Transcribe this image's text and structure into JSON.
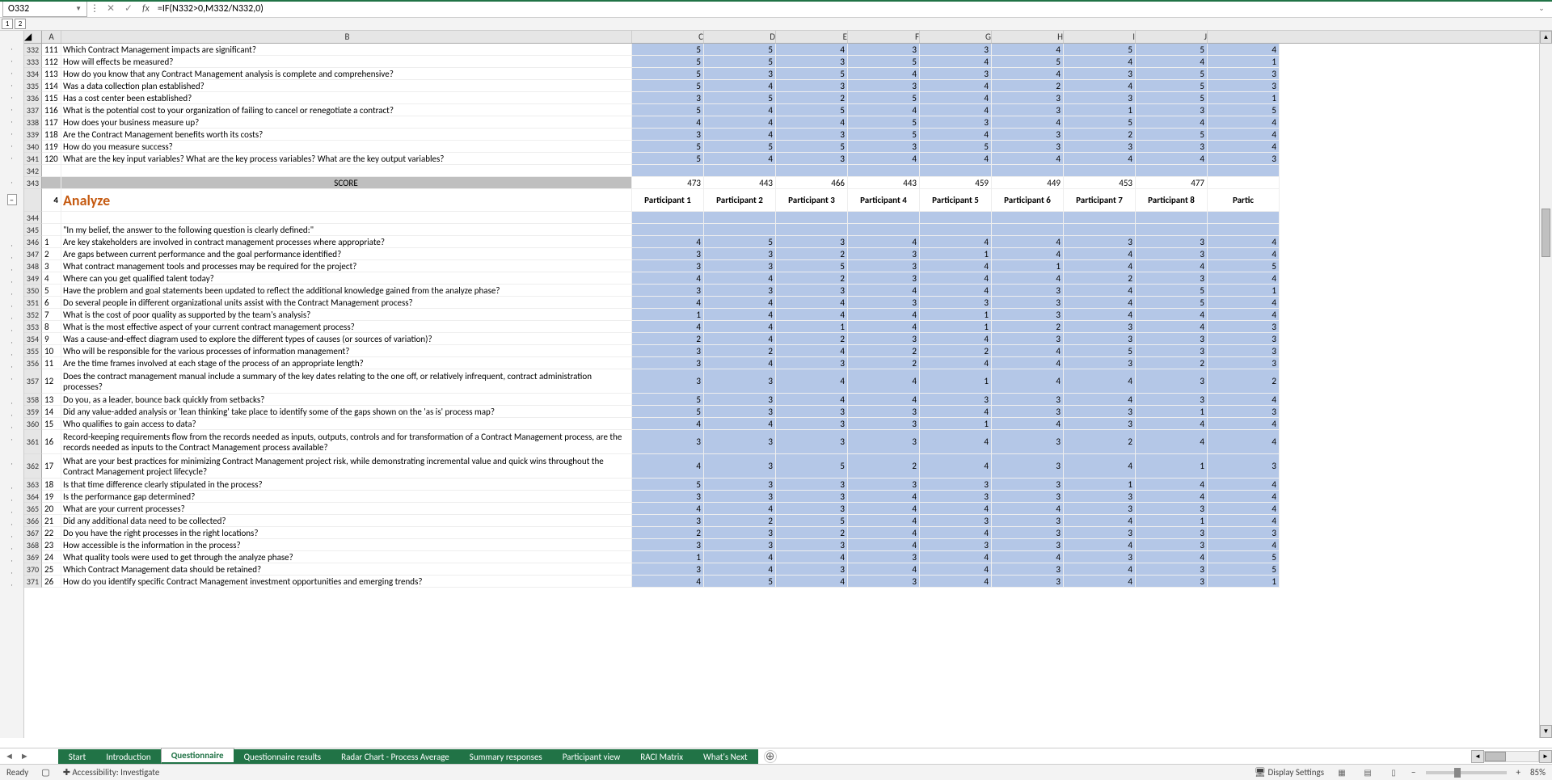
{
  "name_box": "O332",
  "formula": "=IF(N332>0,M332/N332,0)",
  "outline_levels": [
    "1",
    "2"
  ],
  "columns": [
    "A",
    "B",
    "C",
    "D",
    "E",
    "F",
    "G",
    "H",
    "I",
    "J"
  ],
  "rows_top": [
    {
      "r": "332",
      "a": "111",
      "b": "Which Contract Management impacts are significant?",
      "v": [
        "5",
        "5",
        "4",
        "3",
        "3",
        "4",
        "5",
        "5",
        "4"
      ]
    },
    {
      "r": "333",
      "a": "112",
      "b": "How will effects be measured?",
      "v": [
        "5",
        "5",
        "3",
        "5",
        "4",
        "5",
        "4",
        "4",
        "1"
      ]
    },
    {
      "r": "334",
      "a": "113",
      "b": "How do you know that any Contract Management analysis is complete and comprehensive?",
      "v": [
        "5",
        "3",
        "5",
        "4",
        "3",
        "4",
        "3",
        "5",
        "3"
      ]
    },
    {
      "r": "335",
      "a": "114",
      "b": "Was a data collection plan established?",
      "v": [
        "5",
        "4",
        "3",
        "3",
        "4",
        "2",
        "4",
        "5",
        "3"
      ]
    },
    {
      "r": "336",
      "a": "115",
      "b": "Has a cost center been established?",
      "v": [
        "3",
        "5",
        "2",
        "5",
        "4",
        "3",
        "3",
        "5",
        "1"
      ]
    },
    {
      "r": "337",
      "a": "116",
      "b": "What is the potential cost to your organization of failing to cancel or renegotiate a contract?",
      "v": [
        "5",
        "4",
        "5",
        "4",
        "4",
        "3",
        "1",
        "3",
        "5"
      ]
    },
    {
      "r": "338",
      "a": "117",
      "b": "How does your business measure up?",
      "v": [
        "4",
        "4",
        "4",
        "5",
        "3",
        "4",
        "5",
        "4",
        "4"
      ]
    },
    {
      "r": "339",
      "a": "118",
      "b": "Are the Contract Management benefits worth its costs?",
      "v": [
        "3",
        "4",
        "3",
        "5",
        "4",
        "3",
        "2",
        "5",
        "4"
      ]
    },
    {
      "r": "340",
      "a": "119",
      "b": "How do you measure success?",
      "v": [
        "5",
        "5",
        "5",
        "3",
        "5",
        "3",
        "3",
        "3",
        "4"
      ]
    },
    {
      "r": "341",
      "a": "120",
      "b": "What are the key input variables? What are the key process variables? What are the key output variables?",
      "v": [
        "5",
        "4",
        "3",
        "4",
        "4",
        "4",
        "4",
        "4",
        "3"
      ]
    }
  ],
  "row_blank": {
    "r": "342"
  },
  "score_row": {
    "r": "343",
    "label": "SCORE",
    "v": [
      "473",
      "443",
      "466",
      "443",
      "459",
      "449",
      "453",
      "477",
      ""
    ]
  },
  "section": {
    "num": "4",
    "title": "Analyze",
    "headers": [
      "Participant 1",
      "Participant 2",
      "Participant 3",
      "Participant 4",
      "Participant 5",
      "Participant 6",
      "Participant 7",
      "Participant 8",
      "Partic"
    ]
  },
  "row_344": {
    "r": "344"
  },
  "row_intro": {
    "r": "345",
    "b": "\"In my belief, the answer to the following question is clearly defined:\""
  },
  "rows_analyze": [
    {
      "r": "346",
      "a": "1",
      "b": "Are key stakeholders are involved in contract management processes where appropriate?",
      "v": [
        "4",
        "5",
        "3",
        "4",
        "4",
        "4",
        "3",
        "3",
        "4"
      ]
    },
    {
      "r": "347",
      "a": "2",
      "b": "Are gaps between current performance and the goal performance identified?",
      "v": [
        "3",
        "3",
        "2",
        "3",
        "1",
        "4",
        "4",
        "3",
        "4"
      ]
    },
    {
      "r": "348",
      "a": "3",
      "b": "What contract management tools and processes may be required for the project?",
      "v": [
        "3",
        "3",
        "5",
        "3",
        "4",
        "1",
        "4",
        "4",
        "5"
      ]
    },
    {
      "r": "349",
      "a": "4",
      "b": "Where can you get qualified talent today?",
      "v": [
        "4",
        "4",
        "2",
        "3",
        "4",
        "4",
        "2",
        "3",
        "4"
      ]
    },
    {
      "r": "350",
      "a": "5",
      "b": "Have the problem and goal statements been updated to reflect the additional knowledge gained from the analyze phase?",
      "v": [
        "3",
        "3",
        "3",
        "4",
        "4",
        "3",
        "4",
        "5",
        "1"
      ]
    },
    {
      "r": "351",
      "a": "6",
      "b": "Do several people in different organizational units assist with the Contract Management process?",
      "v": [
        "4",
        "4",
        "4",
        "3",
        "3",
        "3",
        "4",
        "5",
        "4"
      ]
    },
    {
      "r": "352",
      "a": "7",
      "b": "What is the cost of poor quality as supported by the team's analysis?",
      "v": [
        "1",
        "4",
        "4",
        "4",
        "1",
        "3",
        "4",
        "4",
        "4"
      ]
    },
    {
      "r": "353",
      "a": "8",
      "b": "What is the most effective aspect of your current contract management process?",
      "v": [
        "4",
        "4",
        "1",
        "4",
        "1",
        "2",
        "3",
        "4",
        "3"
      ]
    },
    {
      "r": "354",
      "a": "9",
      "b": "Was a cause-and-effect diagram used to explore the different types of causes (or sources of variation)?",
      "v": [
        "2",
        "4",
        "2",
        "3",
        "4",
        "3",
        "3",
        "3",
        "3"
      ]
    },
    {
      "r": "355",
      "a": "10",
      "b": "Who will be responsible for the various processes of information management?",
      "v": [
        "3",
        "2",
        "4",
        "2",
        "2",
        "4",
        "5",
        "3",
        "3"
      ]
    },
    {
      "r": "356",
      "a": "11",
      "b": "Are the time frames involved at each stage of the process of an appropriate length?",
      "v": [
        "3",
        "4",
        "3",
        "2",
        "4",
        "4",
        "3",
        "2",
        "3"
      ]
    },
    {
      "r": "357",
      "a": "12",
      "b": "Does the contract management manual include a summary of the key dates relating to the one off, or relatively infrequent, contract administration processes?",
      "v": [
        "3",
        "3",
        "4",
        "4",
        "1",
        "4",
        "4",
        "3",
        "2"
      ],
      "wrap": true
    },
    {
      "r": "358",
      "a": "13",
      "b": "Do you, as a leader, bounce back quickly from setbacks?",
      "v": [
        "5",
        "3",
        "4",
        "4",
        "3",
        "3",
        "4",
        "3",
        "4"
      ]
    },
    {
      "r": "359",
      "a": "14",
      "b": "Did any value-added analysis or 'lean thinking' take place to identify some of the gaps shown on the 'as is' process map?",
      "v": [
        "5",
        "3",
        "3",
        "3",
        "4",
        "3",
        "3",
        "1",
        "3"
      ]
    },
    {
      "r": "360",
      "a": "15",
      "b": "Who qualifies to gain access to data?",
      "v": [
        "4",
        "4",
        "3",
        "3",
        "1",
        "4",
        "3",
        "4",
        "4"
      ]
    },
    {
      "r": "361",
      "a": "16",
      "b": "Record-keeping requirements flow from the records needed as inputs, outputs, controls and for transformation of a Contract Management process, are the records needed as inputs to the Contract Management process available?",
      "v": [
        "3",
        "3",
        "3",
        "3",
        "4",
        "3",
        "2",
        "4",
        "4"
      ],
      "wrap": true
    },
    {
      "r": "362",
      "a": "17",
      "b": "What are your best practices for minimizing Contract Management project risk, while demonstrating incremental value and quick wins throughout the Contract Management project lifecycle?",
      "v": [
        "4",
        "3",
        "5",
        "2",
        "4",
        "3",
        "4",
        "1",
        "3"
      ],
      "wrap": true
    },
    {
      "r": "363",
      "a": "18",
      "b": "Is that time difference clearly stipulated in the process?",
      "v": [
        "5",
        "3",
        "3",
        "3",
        "3",
        "3",
        "1",
        "4",
        "4"
      ]
    },
    {
      "r": "364",
      "a": "19",
      "b": "Is the performance gap determined?",
      "v": [
        "3",
        "3",
        "3",
        "4",
        "3",
        "3",
        "3",
        "4",
        "4"
      ]
    },
    {
      "r": "365",
      "a": "20",
      "b": "What are your current processes?",
      "v": [
        "4",
        "4",
        "3",
        "4",
        "4",
        "4",
        "3",
        "3",
        "4"
      ]
    },
    {
      "r": "366",
      "a": "21",
      "b": "Did any additional data need to be collected?",
      "v": [
        "3",
        "2",
        "5",
        "4",
        "3",
        "3",
        "4",
        "1",
        "4"
      ]
    },
    {
      "r": "367",
      "a": "22",
      "b": "Do you have the right processes in the right locations?",
      "v": [
        "2",
        "3",
        "2",
        "4",
        "4",
        "3",
        "3",
        "3",
        "3"
      ]
    },
    {
      "r": "368",
      "a": "23",
      "b": "How accessible is the information in the process?",
      "v": [
        "3",
        "3",
        "3",
        "4",
        "3",
        "3",
        "4",
        "3",
        "4"
      ]
    },
    {
      "r": "369",
      "a": "24",
      "b": "What quality tools were used to get through the analyze phase?",
      "v": [
        "1",
        "4",
        "4",
        "3",
        "4",
        "4",
        "3",
        "4",
        "5"
      ]
    },
    {
      "r": "370",
      "a": "25",
      "b": "Which Contract Management data should be retained?",
      "v": [
        "3",
        "4",
        "3",
        "4",
        "4",
        "3",
        "4",
        "3",
        "5"
      ]
    },
    {
      "r": "371",
      "a": "26",
      "b": "How do you identify specific Contract Management investment opportunities and emerging trends?",
      "v": [
        "4",
        "5",
        "4",
        "3",
        "4",
        "3",
        "4",
        "3",
        "1"
      ]
    }
  ],
  "tabs": [
    {
      "name": "Start",
      "cls": "colored"
    },
    {
      "name": "Introduction",
      "cls": "colored"
    },
    {
      "name": "Questionnaire",
      "cls": "active"
    },
    {
      "name": "Questionnaire results",
      "cls": "colored"
    },
    {
      "name": "Radar Chart - Process Average",
      "cls": "colored"
    },
    {
      "name": "Summary responses",
      "cls": "colored"
    },
    {
      "name": "Participant view",
      "cls": "colored"
    },
    {
      "name": "RACI Matrix",
      "cls": "colored"
    },
    {
      "name": "What's Next",
      "cls": "colored"
    }
  ],
  "status": {
    "ready": "Ready",
    "accessibility": "Accessibility: Investigate",
    "display": "Display Settings",
    "zoom": "85%"
  }
}
